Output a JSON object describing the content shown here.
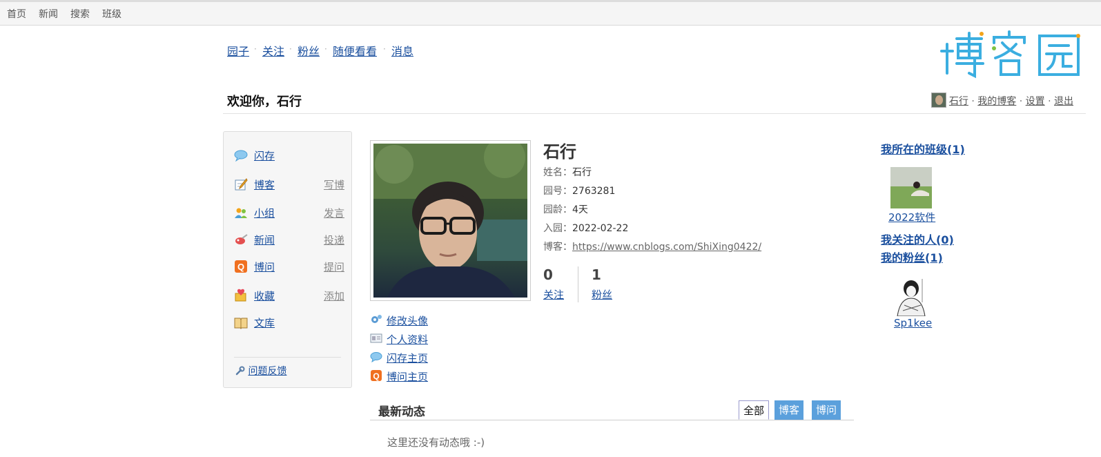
{
  "top_nav": [
    "首页",
    "新闻",
    "搜索",
    "班级"
  ],
  "header_nav": [
    "园子",
    "关注",
    "粉丝",
    "随便看看",
    "消息"
  ],
  "logo": {
    "text": "博客园",
    "colors": [
      "#f3a41a",
      "#3baee0",
      "#7fc241"
    ]
  },
  "welcome": "欢迎你，石行",
  "userbar": {
    "name": "石行",
    "my_blog": "我的博客",
    "settings": "设置",
    "logout": "退出"
  },
  "sidebar": {
    "items": [
      {
        "label": "闪存",
        "action": "",
        "icon": "bubble-icon"
      },
      {
        "label": "博客",
        "action": "写博",
        "icon": "pen-icon"
      },
      {
        "label": "小组",
        "action": "发言",
        "icon": "group-icon"
      },
      {
        "label": "新闻",
        "action": "投递",
        "icon": "news-icon"
      },
      {
        "label": "博问",
        "action": "提问",
        "icon": "q-icon"
      },
      {
        "label": "收藏",
        "action": "添加",
        "icon": "favorite-icon"
      },
      {
        "label": "文库",
        "action": "",
        "icon": "book-icon"
      }
    ],
    "feedback": "问题反馈"
  },
  "profile": {
    "name": "石行",
    "fields": [
      {
        "key": "姓名：",
        "value": "石行"
      },
      {
        "key": "园号：",
        "value": "2763281"
      },
      {
        "key": "园龄：",
        "value": "4天"
      },
      {
        "key": "入园：",
        "value": "2022-02-22"
      },
      {
        "key": "博客：",
        "value": "https://www.cnblogs.com/ShiXing0422/"
      }
    ],
    "following_count": "0",
    "following_label": "关注",
    "followers_count": "1",
    "followers_label": "粉丝"
  },
  "profile_links": [
    {
      "label": "修改头像",
      "icon": "gear-icon"
    },
    {
      "label": "个人资料",
      "icon": "id-card-icon"
    },
    {
      "label": "闪存主页",
      "icon": "bubble-icon"
    },
    {
      "label": "博问主页",
      "icon": "q-icon"
    }
  ],
  "activity": {
    "title": "最新动态",
    "tabs": [
      "全部",
      "博客",
      "博问"
    ],
    "active_tab": "全部",
    "empty": "这里还没有动态哦 :-)"
  },
  "right": {
    "class_heading": "我所在的班级(1)",
    "class_name": "2022软件",
    "following_heading": "我关注的人(0)",
    "followers_heading": "我的粉丝(1)",
    "follower_name": "Sp1kee"
  },
  "colors": {
    "link": "#1a4f9e",
    "tab_inactive": "#5ba0dc"
  }
}
